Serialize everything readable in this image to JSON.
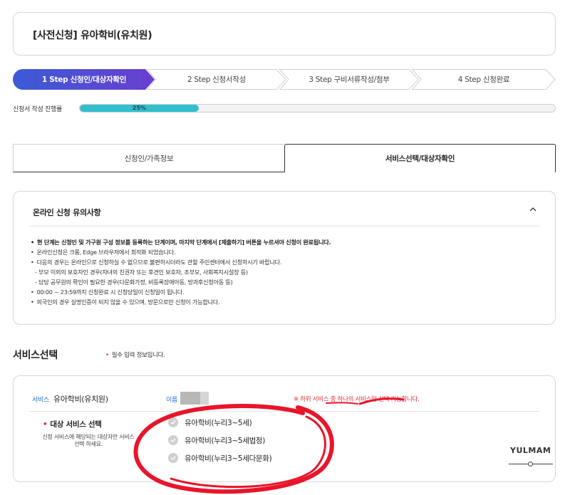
{
  "page_title": "[사전신청] 유아학비(유치원)",
  "steps": [
    {
      "label": "1 Step 신청인/대상자확인",
      "active": true
    },
    {
      "label": "2 Step 신청서작성",
      "active": false
    },
    {
      "label": "3 Step 구비서류작성/첨부",
      "active": false
    },
    {
      "label": "4 Step 신청완료",
      "active": false
    }
  ],
  "progress": {
    "label": "신청서 작성 진행률",
    "value": 25,
    "text": "25%"
  },
  "tabs": [
    {
      "label": "신청인/가족정보",
      "active": false
    },
    {
      "label": "서비스선택/대상자확인",
      "active": true
    }
  ],
  "notice": {
    "title": "온라인 신청 유의사항",
    "items": [
      "현 단계는 신청인 및 가구원 구성 정보를 등록하는 단계이며, 마지막 단계에서 [제출하기] 버튼을 누르셔야 신청이 완료됩니다.",
      "온라인신청은 크롬, Edge 브라우저에서 최적화 되었습니다.",
      "다음의 경우는 온라인으로 신청하실 수 없으므로 불편하시더라도 관할 주민센터에서 신청하시기 바랍니다.",
      "- 부모 이외의 보호자인 경우(자녀의 친권자 또는 후견인 보호자, 조부모, 사회복지시설장 등)",
      "- 담당 공무원의 확인이 필요한 경우(다문화가정, 비등록장애아동, 방과후신청아동 등)",
      "00:00 ~ 23:59까지 신청완료 시 신청당일이 신청일이 됩니다.",
      "외국인의 경우 실명인증이 되지 않을 수 있으며, 방문으로만 신청이 가능합니다."
    ]
  },
  "service_section": {
    "title": "서비스선택",
    "required_note": "필수 입력 정보입니다.",
    "service_label": "서비스",
    "service_name": "유아학비(유치원)",
    "name_label": "이름",
    "warning": "※ 하위 서비스 중 하나의 서비스만 선택 가능합니다.",
    "select_label": "대상 서비스 선택",
    "select_hint": "신청 서비스에 해당되는 대상자만 서비스 선택 하세요.",
    "options": [
      "유아학비(누리3~5세)",
      "유아학비(누리3~5세법정)",
      "유아학비(누리3~5세다문화)"
    ]
  },
  "watermark": "YULMAM",
  "colors": {
    "active_step": "#4a4fcf",
    "progress": "#31bfce",
    "link_blue": "#2a6fd8",
    "required_red": "#e0303a",
    "annotation_red": "#e8152b"
  }
}
